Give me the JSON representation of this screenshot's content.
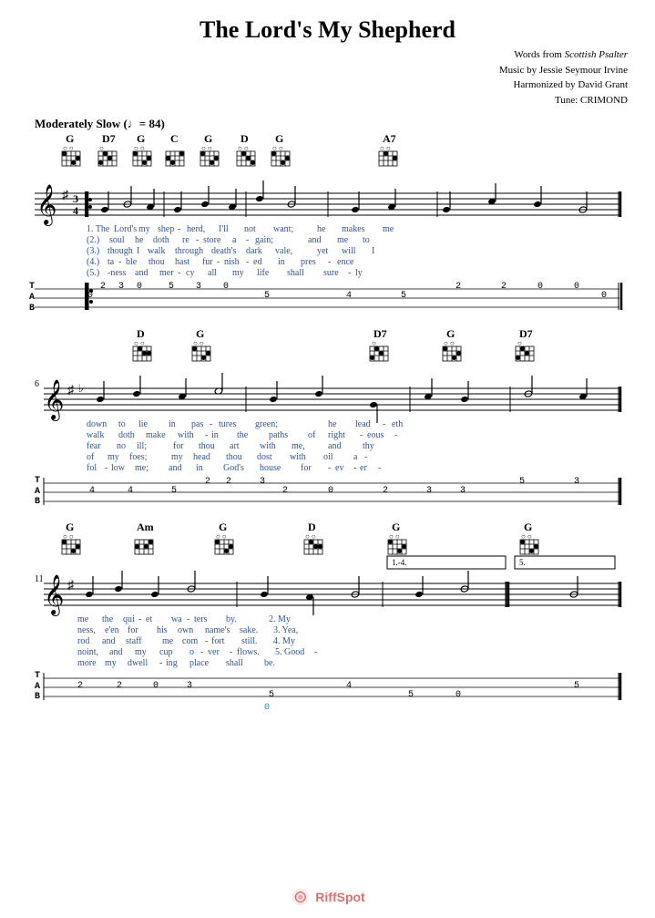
{
  "title": "The Lord's My Shepherd",
  "attribution": {
    "line1_prefix": "Words from ",
    "line1_italic": "Scottish Psalter",
    "line2": "Music by Jessie Seymour Irvine",
    "line3": "Harmonized by David Grant",
    "line4": "Tune: CRIMOND"
  },
  "tempo": {
    "label": "Moderately Slow",
    "symbol": "♩",
    "value": "= 84"
  },
  "sections": [
    {
      "id": "section1",
      "measure_start": 1,
      "chords": [
        "G",
        "D7",
        "G",
        "C",
        "G",
        "D",
        "G",
        "A7"
      ],
      "tab": {
        "T": "T",
        "A": "A|---0-----2--3-0---5---3-0---|-------5---4---5------|--2---2-0-0--0-|",
        "B": "B|                             |                      |               |"
      },
      "lyrics": [
        {
          "num": "1.",
          "words": [
            "The",
            "Lord's",
            "my",
            "shep",
            "-",
            "herd,",
            "I'll",
            "not",
            "want;",
            "he",
            "makes",
            "me"
          ]
        },
        {
          "num": "(2.)",
          "words": [
            "soul",
            "he",
            "doth",
            "re",
            "-",
            "store",
            "a",
            "-",
            "gain;",
            "and",
            "me",
            "to"
          ]
        },
        {
          "num": "(3.)",
          "words": [
            "though",
            "I",
            "walk",
            "through",
            "death's",
            "dark",
            "vale,",
            "yet",
            "will",
            "I"
          ]
        },
        {
          "num": "(4.)",
          "words": [
            "ta",
            "-",
            "ble",
            "thou",
            "hast",
            "fur",
            "-",
            "nish",
            "-",
            "ed",
            "in",
            "pres",
            "-",
            "ence"
          ]
        },
        {
          "num": "(5.)",
          "words": [
            "-",
            "ness",
            "and",
            "mer",
            "-",
            "cy",
            "all",
            "my",
            "life",
            "shall",
            "sure",
            "-",
            "ly"
          ]
        }
      ]
    },
    {
      "id": "section2",
      "measure_start": 6,
      "chords": [
        "D",
        "G",
        "D7",
        "G",
        "D7"
      ],
      "tab": {
        "A": "A|--4---4--5---2--2---3-2---0---|-2---3---3--5--3-|",
        "B": "B|                               |                  |"
      },
      "lyrics": [
        {
          "num": "",
          "words": [
            "down",
            "to",
            "lie",
            "in",
            "pas",
            "-",
            "tures",
            "green;",
            "he",
            "lead",
            "-",
            "eth"
          ]
        },
        {
          "num": "",
          "words": [
            "walk",
            "doth",
            "make",
            "with",
            "-",
            "in",
            "the",
            "paths",
            "of",
            "right",
            "-",
            "eous",
            "-"
          ]
        },
        {
          "num": "",
          "words": [
            "fear",
            "no",
            "ill;",
            "for",
            "thou",
            "art",
            "with",
            "me,",
            "and",
            "thy"
          ]
        },
        {
          "num": "",
          "words": [
            "of",
            "my",
            "foes;",
            "my",
            "head",
            "thou",
            "dost",
            "with",
            "oil",
            "a",
            "-"
          ]
        },
        {
          "num": "",
          "words": [
            "fol",
            "-",
            "low",
            "me;",
            "and",
            "in",
            "God's",
            "house",
            "for",
            "-",
            "ev",
            "-",
            "er",
            "-"
          ]
        }
      ]
    },
    {
      "id": "section3",
      "measure_start": 11,
      "chords": [
        "G",
        "Am",
        "G",
        "D",
        "G",
        "G"
      ],
      "tab": {
        "A": "A|--2---2--0---3--|--5---4--5---0---|--5--|",
        "B": "B|                 |                 |     |"
      },
      "lyrics": [
        {
          "num": "",
          "words": [
            "me",
            "the",
            "qui",
            "-",
            "et",
            "wa",
            "-",
            "ters",
            "by.",
            "2. My"
          ]
        },
        {
          "num": "",
          "words": [
            "ness,",
            "e'en",
            "for",
            "his",
            "own",
            "name's",
            "sake.",
            "3. Yea,"
          ]
        },
        {
          "num": "",
          "words": [
            "rod",
            "and",
            "staff",
            "me",
            "com",
            "-",
            "fort",
            "still.",
            "4. My"
          ]
        },
        {
          "num": "",
          "words": [
            "noint,",
            "and",
            "my",
            "cup",
            "o",
            "-",
            "ver",
            "-",
            "flows.",
            "5. Good",
            "-"
          ]
        },
        {
          "num": "",
          "words": [
            "more",
            "my",
            "dwell",
            "-",
            "ing",
            "place",
            "shall",
            "be."
          ]
        }
      ]
    }
  ],
  "watermark": {
    "brand": "RiffSpot",
    "icon_color": "#cc3333"
  }
}
